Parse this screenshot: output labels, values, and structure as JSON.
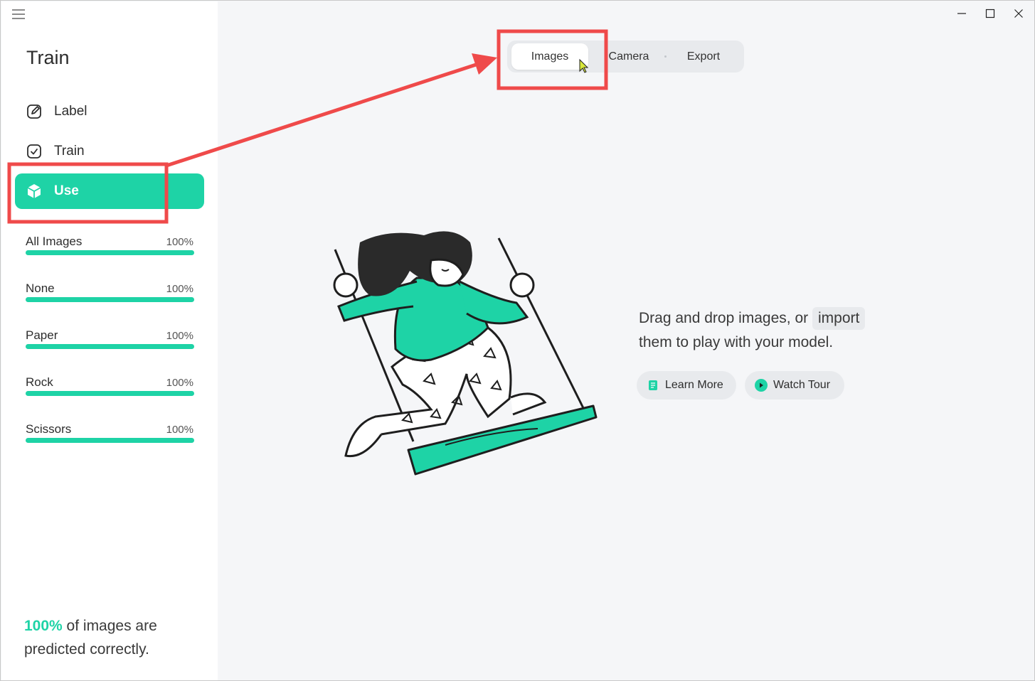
{
  "sidebar": {
    "title": "Train",
    "nav": [
      {
        "label": "Label",
        "icon": "edit-icon"
      },
      {
        "label": "Train",
        "icon": "checkbox-icon"
      },
      {
        "label": "Use",
        "icon": "cube-icon",
        "active": true
      }
    ],
    "classes": [
      {
        "name": "All Images",
        "percent": "100%",
        "accuracy": 1.0
      },
      {
        "name": "None",
        "percent": "100%",
        "accuracy": 1.0
      },
      {
        "name": "Paper",
        "percent": "100%",
        "accuracy": 1.0
      },
      {
        "name": "Rock",
        "percent": "100%",
        "accuracy": 1.0
      },
      {
        "name": "Scissors",
        "percent": "100%",
        "accuracy": 1.0
      }
    ],
    "summary": {
      "percent": "100%",
      "text_a": " of images are",
      "text_b": "predicted correctly."
    }
  },
  "tabs": [
    {
      "label": "Images",
      "active": true
    },
    {
      "label": "Camera",
      "active": false
    },
    {
      "label": "Export",
      "active": false
    }
  ],
  "empty_state": {
    "line1": "Drag and drop images, or",
    "import_label": "import",
    "line2": "them to play with your model.",
    "learn_more": "Learn More",
    "watch_tour": "Watch Tour"
  },
  "colors": {
    "accent": "#1ed3a6",
    "annotation": "#ef4a4a"
  },
  "window_controls": [
    "minimize-icon",
    "maximize-icon",
    "close-icon"
  ]
}
